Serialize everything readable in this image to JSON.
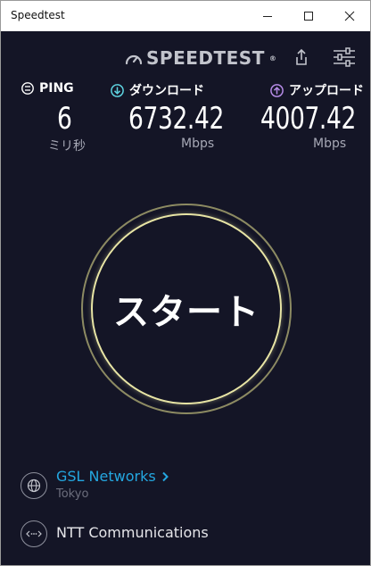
{
  "window": {
    "title": "Speedtest"
  },
  "brand": {
    "logo_text": "SPEEDTEST",
    "trademark": "®"
  },
  "metrics": {
    "ping": {
      "label": "PING",
      "value": "6",
      "unit": "ミリ秒"
    },
    "download": {
      "label": "ダウンロード",
      "value": "6732.42",
      "unit": "Mbps"
    },
    "upload": {
      "label": "アップロード",
      "value": "4007.42",
      "unit": "Mbps"
    }
  },
  "start_button": {
    "label": "スタート"
  },
  "provider": {
    "isp_name": "GSL Networks",
    "isp_location": "Tokyo",
    "server_name": "NTT Communications"
  },
  "colors": {
    "background": "#141526",
    "accent_blue": "#24a7e0",
    "download_icon": "#5ed3e0",
    "upload_icon": "#b58be6",
    "ring_inner": "#e8e5a5",
    "ring_outer": "#8c8a62"
  },
  "icons": {
    "ping": "ping-icon",
    "download": "download-arrow-icon",
    "upload": "upload-arrow-icon",
    "share": "share-icon",
    "settings": "settings-sliders-icon",
    "isp": "globe-icon",
    "server": "server-link-icon"
  }
}
